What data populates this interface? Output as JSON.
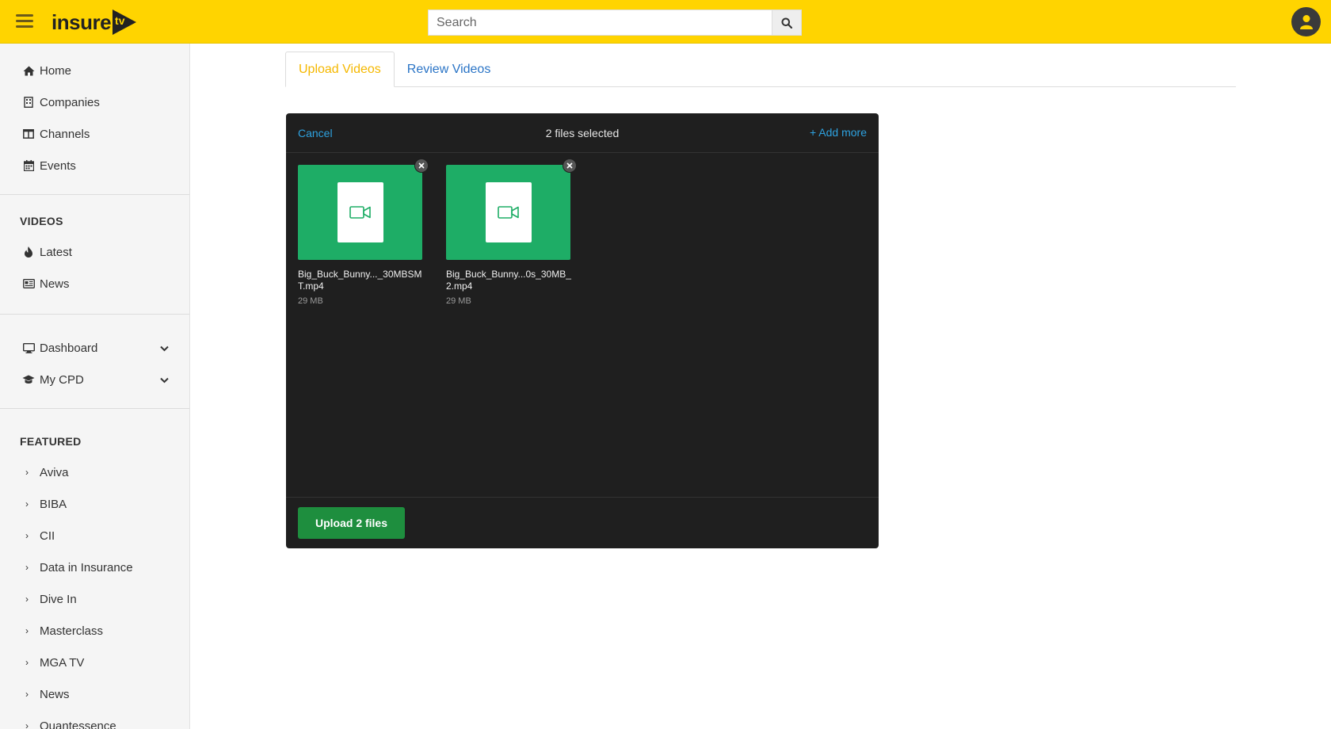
{
  "header": {
    "logo_text": "insure",
    "logo_badge": "tv",
    "search_placeholder": "Search",
    "brand_color": "#ffd400"
  },
  "sidebar": {
    "main": [
      {
        "label": "Home",
        "icon": "home-icon"
      },
      {
        "label": "Companies",
        "icon": "building-icon"
      },
      {
        "label": "Channels",
        "icon": "columns-icon"
      },
      {
        "label": "Events",
        "icon": "calendar-icon"
      }
    ],
    "videos_title": "VIDEOS",
    "videos": [
      {
        "label": "Latest",
        "icon": "fire-icon"
      },
      {
        "label": "News",
        "icon": "newspaper-icon"
      }
    ],
    "dash": [
      {
        "label": "Dashboard",
        "icon": "monitor-icon"
      },
      {
        "label": "My CPD",
        "icon": "graduation-cap-icon"
      }
    ],
    "featured_title": "FEATURED",
    "featured": [
      "Aviva",
      "BIBA",
      "CII",
      "Data in Insurance",
      "Dive In",
      "Masterclass",
      "MGA TV",
      "News",
      "Quantessence"
    ]
  },
  "tabs": {
    "upload": "Upload Videos",
    "review": "Review Videos"
  },
  "uploader": {
    "cancel": "Cancel",
    "count": "2 files selected",
    "add_more": "+ Add more",
    "files": [
      {
        "name": "Big_Buck_Bunny..._30MBSMT.mp4",
        "size": "29 MB"
      },
      {
        "name": "Big_Buck_Bunny...0s_30MB_2.mp4",
        "size": "29 MB"
      }
    ],
    "upload_button": "Upload 2 files"
  }
}
